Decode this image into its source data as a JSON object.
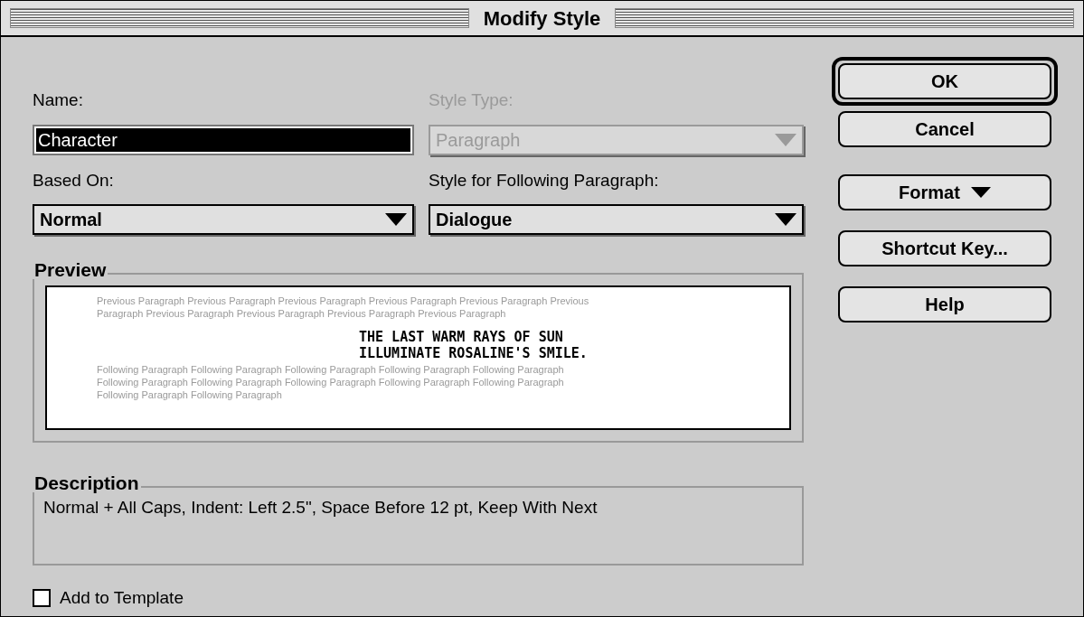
{
  "window": {
    "title": "Modify Style"
  },
  "name": {
    "label": "Name:",
    "value": "Character",
    "selected": true
  },
  "style_type": {
    "label": "Style Type:",
    "value": "Paragraph",
    "disabled": true
  },
  "based_on": {
    "label": "Based On:",
    "value": "Normal",
    "disabled": false
  },
  "following": {
    "label": "Style for Following Paragraph:",
    "value": "Dialogue",
    "disabled": false
  },
  "preview": {
    "label": "Preview",
    "previous_lines": [
      "Previous Paragraph Previous Paragraph Previous Paragraph Previous Paragraph Previous Paragraph Previous",
      "Paragraph Previous Paragraph Previous Paragraph Previous Paragraph Previous Paragraph"
    ],
    "sample_lines": [
      "THE LAST WARM RAYS OF SUN",
      "ILLUMINATE ROSALINE'S SMILE."
    ],
    "following_lines": [
      "Following Paragraph Following Paragraph Following Paragraph Following Paragraph Following Paragraph",
      "Following Paragraph Following Paragraph Following Paragraph Following Paragraph Following Paragraph",
      "Following Paragraph Following Paragraph"
    ]
  },
  "description": {
    "label": "Description",
    "text": "Normal + All Caps, Indent:  Left  2.5\", Space Before 12 pt, Keep With Next"
  },
  "add_to_template": {
    "label": "Add to Template",
    "checked": false
  },
  "primary_buttons": [
    {
      "label": "OK",
      "kind": "default"
    },
    {
      "label": "Cancel",
      "kind": "plain"
    }
  ],
  "secondary_buttons": [
    {
      "label": "Format",
      "kind": "menu"
    },
    {
      "label": "Shortcut Key...",
      "kind": "plain"
    },
    {
      "label": "Help",
      "kind": "plain"
    }
  ]
}
